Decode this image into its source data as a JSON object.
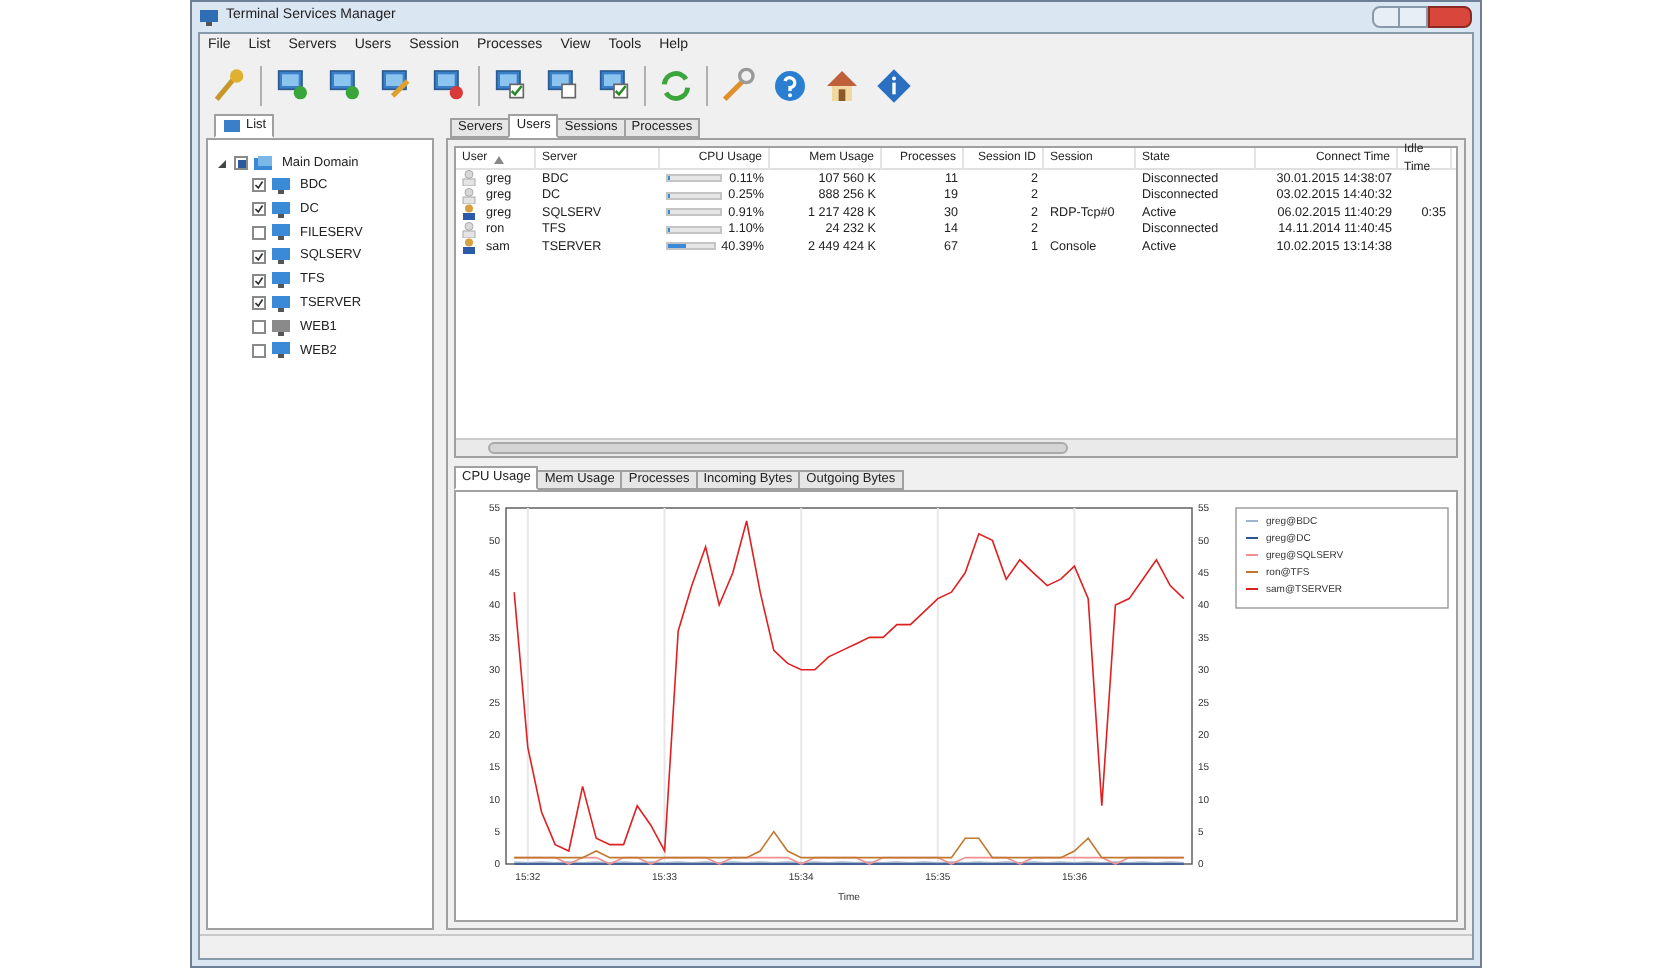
{
  "window": {
    "title": "Terminal Services Manager"
  },
  "menu": [
    "File",
    "List",
    "Servers",
    "Users",
    "Session",
    "Processes",
    "View",
    "Tools",
    "Help"
  ],
  "toolbar": [
    {
      "kind": "key"
    },
    {
      "kind": "sep"
    },
    {
      "kind": "add"
    },
    {
      "kind": "add"
    },
    {
      "kind": "edit"
    },
    {
      "kind": "remove"
    },
    {
      "kind": "sep"
    },
    {
      "kind": "check"
    },
    {
      "kind": "blank"
    },
    {
      "kind": "check"
    },
    {
      "kind": "sep"
    },
    {
      "kind": "refresh"
    },
    {
      "kind": "sep"
    },
    {
      "kind": "wrench"
    },
    {
      "kind": "help"
    },
    {
      "kind": "home"
    },
    {
      "kind": "info"
    }
  ],
  "left_tabs": [
    {
      "label": "List",
      "selected": true
    }
  ],
  "tree": [
    {
      "label": "Main Domain",
      "expanded": true,
      "indeterminate": true,
      "children": [
        {
          "label": "BDC",
          "checked": true,
          "online": true
        },
        {
          "label": "DC",
          "checked": true,
          "online": true
        },
        {
          "label": "FILESERV",
          "checked": false,
          "online": true
        },
        {
          "label": "SQLSERV",
          "checked": true,
          "online": true
        },
        {
          "label": "TFS",
          "checked": true,
          "online": true
        },
        {
          "label": "TSERVER",
          "checked": true,
          "online": true
        },
        {
          "label": "WEB1",
          "checked": false,
          "online": false
        },
        {
          "label": "WEB2",
          "checked": false,
          "online": true
        }
      ]
    }
  ],
  "tabs": [
    {
      "label": "Servers",
      "selected": false
    },
    {
      "label": "Users",
      "selected": true
    },
    {
      "label": "Sessions",
      "selected": false
    },
    {
      "label": "Processes",
      "selected": false
    }
  ],
  "table": {
    "columns": [
      "User",
      "Server",
      "CPU Usage",
      "Mem Usage",
      "Processes",
      "Session ID",
      "Session",
      "State",
      "Connect Time",
      "Idle Time"
    ],
    "rows": [
      {
        "user": "greg",
        "active": false,
        "server": "BDC",
        "level": 0.0011,
        "cpu": "0.11%",
        "mem": "107 560 K",
        "processes": "11",
        "session_id": "2",
        "state": "Disconnected",
        "connect_time": "30.01.2015 14:38:07"
      },
      {
        "user": "greg",
        "active": false,
        "server": "DC",
        "level": 0.0025,
        "cpu": "0.25%",
        "mem": "888 256 K",
        "processes": "19",
        "session_id": "2",
        "state": "Disconnected",
        "connect_time": "03.02.2015 14:40:32"
      },
      {
        "user": "greg",
        "active": true,
        "server": "SQLSERV",
        "level": 0.0091,
        "cpu": "0.91%",
        "mem": "1 217 428 K",
        "processes": "30",
        "session_id": "2",
        "session": "RDP-Tcp#0",
        "state": "Active",
        "connect_time": "06.02.2015 11:40:29",
        "idle_time": "0:35"
      },
      {
        "user": "ron",
        "active": false,
        "server": "TFS",
        "level": 0.011,
        "cpu": "1.10%",
        "mem": "24 232 K",
        "processes": "14",
        "session_id": "2",
        "state": "Disconnected",
        "connect_time": "14.11.2014 11:40:45"
      },
      {
        "user": "sam",
        "active": true,
        "server": "TSERVER",
        "level": 0.4039,
        "cpu": "40.39%",
        "mem": "2 449 424 K",
        "processes": "67",
        "session_id": "1",
        "session": "Console",
        "state": "Active",
        "connect_time": "10.02.2015 13:14:38"
      }
    ]
  },
  "chart_tabs": [
    {
      "label": "CPU Usage",
      "selected": true
    },
    {
      "label": "Mem Usage",
      "selected": false
    },
    {
      "label": "Processes",
      "selected": false
    },
    {
      "label": "Incoming Bytes",
      "selected": false
    },
    {
      "label": "Outgoing Bytes",
      "selected": false
    }
  ],
  "chart_data": {
    "type": "line",
    "xlabel": "Time",
    "ylim": [
      0,
      55
    ],
    "y2lim": [
      0,
      55
    ],
    "grid": true,
    "legend": "right",
    "yticks": [
      0,
      5,
      10,
      15,
      20,
      25,
      30,
      35,
      40,
      45,
      50,
      55
    ],
    "y2ticks": [
      0,
      5,
      10,
      15,
      20,
      25,
      30,
      35,
      40,
      45,
      50,
      55
    ],
    "categories": [
      null,
      "15:32",
      null,
      null,
      null,
      null,
      null,
      null,
      null,
      null,
      null,
      "15:33",
      null,
      null,
      null,
      null,
      null,
      null,
      null,
      null,
      null,
      "15:34",
      null,
      null,
      null,
      null,
      null,
      null,
      null,
      null,
      null,
      "15:35",
      null,
      null,
      null,
      null,
      null,
      null,
      null,
      null,
      null,
      "15:36",
      null,
      null,
      null,
      null,
      null,
      null,
      null,
      null
    ],
    "series": [
      {
        "name": "greg@BDC",
        "color": "#9fb4cc",
        "values": [
          0.3,
          0.2,
          0.3,
          0.2,
          0.3,
          0.2,
          0.3,
          0.2,
          0.3,
          0.2,
          0.3,
          0.2,
          0.3,
          0.2,
          0.3,
          0.2,
          0.3,
          0.2,
          0.3,
          0.2,
          0.3,
          0.2,
          0.3,
          0.2,
          0.3,
          0.2,
          0.3,
          0.2,
          0.3,
          0.2,
          0.3,
          0.2,
          0.3,
          0.2,
          0.3,
          0.2,
          0.3,
          0.2,
          0.3,
          0.2,
          0.3,
          0.2,
          0.3,
          0.2,
          0.3,
          0.2,
          0.3,
          0.2,
          0.3,
          0.2
        ]
      },
      {
        "name": "greg@DC",
        "color": "#2f5597",
        "values": [
          0,
          0,
          0,
          0,
          0,
          0,
          0,
          0,
          0,
          0,
          0,
          0,
          0,
          0,
          0,
          0,
          0,
          0,
          0,
          0,
          0,
          0,
          0,
          0,
          0,
          0,
          0,
          0,
          0,
          0,
          0,
          0,
          0,
          0,
          0,
          0,
          0,
          0,
          0,
          0,
          0,
          0,
          0,
          0,
          0,
          0,
          0,
          0,
          0,
          0
        ]
      },
      {
        "name": "greg@SQLSERV",
        "color": "#f09090",
        "values": [
          1,
          1,
          1,
          1,
          0,
          1,
          1,
          0,
          1,
          1,
          0,
          1,
          1,
          1,
          1,
          0,
          1,
          1,
          1,
          1,
          1,
          0,
          1,
          1,
          1,
          1,
          0,
          1,
          1,
          1,
          1,
          1,
          0,
          1,
          1,
          1,
          1,
          0,
          1,
          1,
          1,
          1,
          1,
          1,
          0,
          1,
          1,
          1,
          1,
          1
        ]
      },
      {
        "name": "ron@TFS",
        "color": "#c07830",
        "values": [
          1,
          1,
          1,
          1,
          1,
          1,
          2,
          1,
          1,
          1,
          1,
          1,
          1,
          1,
          1,
          1,
          1,
          1,
          2,
          5,
          2,
          1,
          1,
          1,
          1,
          1,
          1,
          1,
          1,
          1,
          1,
          1,
          1,
          4,
          4,
          1,
          1,
          1,
          1,
          1,
          1,
          2,
          4,
          1,
          1,
          1,
          1,
          1,
          1,
          1
        ]
      },
      {
        "name": "sam@TSERVER",
        "color": "#e02020",
        "values": [
          42,
          18,
          8,
          3,
          2,
          12,
          4,
          3,
          3,
          9,
          6,
          2,
          36,
          43,
          49,
          40,
          45,
          53,
          42,
          33,
          31,
          30,
          30,
          32,
          33,
          34,
          35,
          35,
          37,
          37,
          39,
          41,
          42,
          45,
          51,
          50,
          44,
          47,
          45,
          43,
          44,
          46,
          41,
          9,
          40,
          41,
          44,
          47,
          43,
          41
        ]
      }
    ]
  }
}
